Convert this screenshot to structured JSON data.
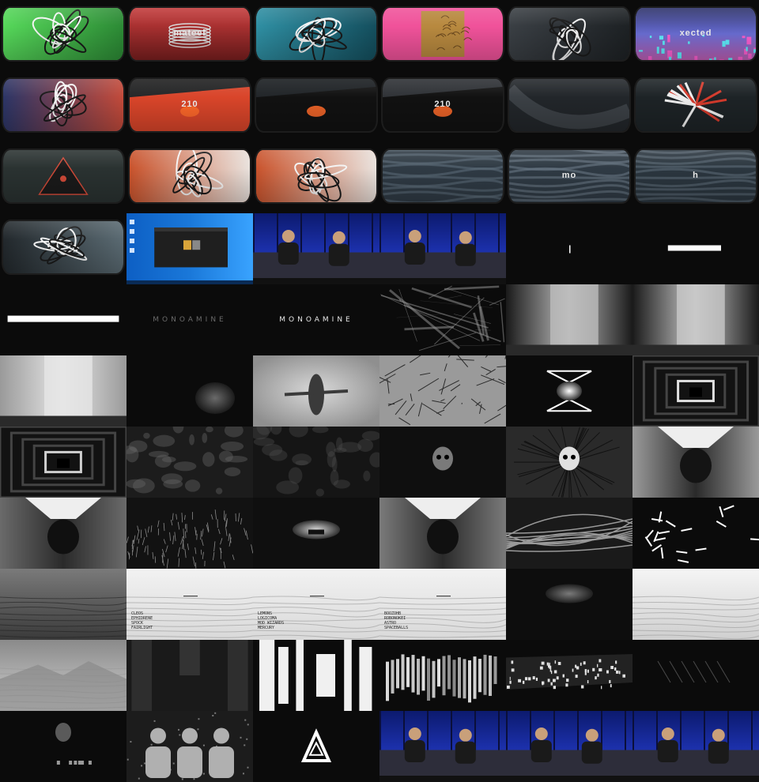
{
  "grid": {
    "columns": 6,
    "rows": 11,
    "background": "#0b0b0b"
  },
  "frames": [
    {
      "row": 0,
      "col": 0,
      "style": "crt",
      "scene": "green-twist",
      "colors": [
        "#56d85a",
        "#2c8a35"
      ],
      "caption": ""
    },
    {
      "row": 0,
      "col": 1,
      "style": "crt",
      "scene": "red-rings",
      "colors": [
        "#c23a3a",
        "#7a1f1f"
      ],
      "caption": "mateel"
    },
    {
      "row": 0,
      "col": 2,
      "style": "crt",
      "scene": "teal-knot",
      "colors": [
        "#2f8fa3",
        "#144f5e"
      ],
      "caption": ""
    },
    {
      "row": 0,
      "col": 3,
      "style": "crt",
      "scene": "pink-gold",
      "colors": [
        "#f0529a",
        "#b8893f"
      ],
      "caption": ""
    },
    {
      "row": 0,
      "col": 4,
      "style": "crt",
      "scene": "grey-chrome",
      "colors": [
        "#3a3f44",
        "#1d2124"
      ],
      "caption": ""
    },
    {
      "row": 0,
      "col": 5,
      "style": "crt",
      "scene": "purple-city",
      "colors": [
        "#6b6fd6",
        "#c05fb5"
      ],
      "caption": "xected"
    },
    {
      "row": 1,
      "col": 0,
      "style": "crt",
      "scene": "navy-swirl",
      "colors": [
        "#2c3566",
        "#c24a3a"
      ],
      "caption": ""
    },
    {
      "row": 1,
      "col": 1,
      "style": "crt",
      "scene": "210-red",
      "colors": [
        "#1c1c1c",
        "#d9452a"
      ],
      "caption": "210"
    },
    {
      "row": 1,
      "col": 2,
      "style": "crt",
      "scene": "210-dark",
      "colors": [
        "#15191c",
        "#d9452a"
      ],
      "caption": ""
    },
    {
      "row": 1,
      "col": 3,
      "style": "crt",
      "scene": "210-grey",
      "colors": [
        "#2a2d31",
        "#cc4a2a"
      ],
      "caption": "210"
    },
    {
      "row": 1,
      "col": 4,
      "style": "crt",
      "scene": "dark-curve",
      "colors": [
        "#22262a",
        "#3b4045"
      ],
      "caption": ""
    },
    {
      "row": 1,
      "col": 5,
      "style": "crt",
      "scene": "red-burst",
      "colors": [
        "#1d2326",
        "#d33a2c"
      ],
      "caption": ""
    },
    {
      "row": 2,
      "col": 0,
      "style": "crt",
      "scene": "dark-pyramid",
      "colors": [
        "#2a3231",
        "#d14a38"
      ],
      "caption": ""
    },
    {
      "row": 2,
      "col": 1,
      "style": "crt",
      "scene": "orange-chrome",
      "colors": [
        "#c9532c",
        "#e9e2dd"
      ],
      "caption": ""
    },
    {
      "row": 2,
      "col": 2,
      "style": "crt",
      "scene": "orange-chrome",
      "colors": [
        "#c9532c",
        "#e9e2dd"
      ],
      "caption": ""
    },
    {
      "row": 2,
      "col": 3,
      "style": "crt",
      "scene": "fabric",
      "colors": [
        "#2f3a44",
        "#5c6b78"
      ],
      "caption": ""
    },
    {
      "row": 2,
      "col": 4,
      "style": "crt",
      "scene": "fabric",
      "colors": [
        "#2f3a44",
        "#6a7885"
      ],
      "caption": "mo"
    },
    {
      "row": 2,
      "col": 5,
      "style": "crt",
      "scene": "fabric",
      "colors": [
        "#2b363f",
        "#5b6a76"
      ],
      "caption": "h"
    },
    {
      "row": 3,
      "col": 0,
      "style": "crt",
      "scene": "dark-logo",
      "colors": [
        "#22282c",
        "#5a6a72"
      ],
      "caption": ""
    },
    {
      "row": 3,
      "col": 1,
      "style": "full",
      "scene": "desktop",
      "colors": [
        "#1a78d9",
        "#1f1f1f"
      ],
      "caption": ""
    },
    {
      "row": 3,
      "col": 2,
      "style": "full",
      "scene": "stage",
      "colors": [
        "#1b2fa8",
        "#2d2d3a"
      ],
      "caption": ""
    },
    {
      "row": 3,
      "col": 3,
      "style": "full",
      "scene": "stage",
      "colors": [
        "#1b2fa8",
        "#2d2d3a"
      ],
      "caption": ""
    },
    {
      "row": 3,
      "col": 4,
      "style": "full",
      "scene": "tick",
      "colors": [
        "#0b0b0b",
        "#ffffff"
      ],
      "caption": ""
    },
    {
      "row": 3,
      "col": 5,
      "style": "full",
      "scene": "bar",
      "colors": [
        "#0b0b0b",
        "#ffffff"
      ],
      "caption": ""
    },
    {
      "row": 4,
      "col": 0,
      "style": "full",
      "scene": "bar-wide",
      "colors": [
        "#0b0b0b",
        "#ffffff"
      ],
      "caption": ""
    },
    {
      "row": 4,
      "col": 1,
      "style": "full",
      "scene": "title",
      "colors": [
        "#0b0b0b",
        "#6a6a6a"
      ],
      "caption": "MONOAMINE"
    },
    {
      "row": 4,
      "col": 2,
      "style": "full",
      "scene": "title-bright",
      "colors": [
        "#0b0b0b",
        "#ffffff"
      ],
      "caption": "MONOAMINE"
    },
    {
      "row": 4,
      "col": 3,
      "style": "full",
      "scene": "shards",
      "colors": [
        "#0b0b0b",
        "#9a9a9a"
      ],
      "caption": ""
    },
    {
      "row": 4,
      "col": 4,
      "style": "full",
      "scene": "room",
      "colors": [
        "#1a1a1a",
        "#bdbdbd"
      ],
      "caption": ""
    },
    {
      "row": 4,
      "col": 5,
      "style": "full",
      "scene": "room",
      "colors": [
        "#1a1a1a",
        "#c8c8c8"
      ],
      "caption": ""
    },
    {
      "row": 5,
      "col": 0,
      "style": "full",
      "scene": "room-wide",
      "colors": [
        "#9a9a9a",
        "#e6e6e6"
      ],
      "caption": ""
    },
    {
      "row": 5,
      "col": 1,
      "style": "full",
      "scene": "glow",
      "colors": [
        "#0b0b0b",
        "#5a5a5a"
      ],
      "caption": ""
    },
    {
      "row": 5,
      "col": 2,
      "style": "full",
      "scene": "figure",
      "colors": [
        "#8f8f8f",
        "#3a3a3a"
      ],
      "caption": ""
    },
    {
      "row": 5,
      "col": 3,
      "style": "full",
      "scene": "splinters",
      "colors": [
        "#9a9a9a",
        "#2a2a2a"
      ],
      "caption": ""
    },
    {
      "row": 5,
      "col": 4,
      "style": "full",
      "scene": "diamond",
      "colors": [
        "#0b0b0b",
        "#ffffff"
      ],
      "caption": ""
    },
    {
      "row": 5,
      "col": 5,
      "style": "full",
      "scene": "tunnel",
      "colors": [
        "#121212",
        "#e0e0e0"
      ],
      "caption": ""
    },
    {
      "row": 6,
      "col": 0,
      "style": "full",
      "scene": "tunnel",
      "colors": [
        "#121212",
        "#d0d0d0"
      ],
      "caption": ""
    },
    {
      "row": 6,
      "col": 1,
      "style": "full",
      "scene": "organic",
      "colors": [
        "#1c1c1c",
        "#6a6a6a"
      ],
      "caption": ""
    },
    {
      "row": 6,
      "col": 2,
      "style": "full",
      "scene": "organic",
      "colors": [
        "#151515",
        "#4a4a4a"
      ],
      "caption": ""
    },
    {
      "row": 6,
      "col": 3,
      "style": "full",
      "scene": "skull-blur",
      "colors": [
        "#0f0f0f",
        "#7a7a7a"
      ],
      "caption": ""
    },
    {
      "row": 6,
      "col": 4,
      "style": "full",
      "scene": "skull",
      "colors": [
        "#2a2a2a",
        "#e0e0e0"
      ],
      "caption": ""
    },
    {
      "row": 6,
      "col": 5,
      "style": "full",
      "scene": "chrome-room",
      "colors": [
        "#9a9a9a",
        "#141414"
      ],
      "caption": ""
    },
    {
      "row": 7,
      "col": 0,
      "style": "full",
      "scene": "chrome-room",
      "colors": [
        "#6a6a6a",
        "#101010"
      ],
      "caption": ""
    },
    {
      "row": 7,
      "col": 1,
      "style": "full",
      "scene": "grass",
      "colors": [
        "#121212",
        "#8a8a8a"
      ],
      "caption": ""
    },
    {
      "row": 7,
      "col": 2,
      "style": "full",
      "scene": "glow-floor",
      "colors": [
        "#0f0f0f",
        "#d6d6d6"
      ],
      "caption": ""
    },
    {
      "row": 7,
      "col": 3,
      "style": "full",
      "scene": "chrome-room",
      "colors": [
        "#7a7a7a",
        "#101010"
      ],
      "caption": ""
    },
    {
      "row": 7,
      "col": 4,
      "style": "full",
      "scene": "cables",
      "colors": [
        "#1a1a1a",
        "#9a9a9a"
      ],
      "caption": ""
    },
    {
      "row": 7,
      "col": 5,
      "style": "full",
      "scene": "sticks",
      "colors": [
        "#0b0b0b",
        "#ffffff"
      ],
      "caption": ""
    },
    {
      "row": 8,
      "col": 0,
      "style": "full",
      "scene": "terrain-dark",
      "colors": [
        "#3a3a3a",
        "#7a7a7a"
      ],
      "caption": ""
    },
    {
      "row": 8,
      "col": 1,
      "style": "full",
      "scene": "snow-credits",
      "colors": [
        "#d9d9d9",
        "#f2f2f2"
      ],
      "caption": "CLEOS\nEPHIDRENE\nSPOCK\nFAIRLIGHT"
    },
    {
      "row": 8,
      "col": 2,
      "style": "full",
      "scene": "snow-credits",
      "colors": [
        "#d9d9d9",
        "#f2f2f2"
      ],
      "caption": "LEMONS\nLOGICOMA\nMOD WIZARDS\nMERCURY"
    },
    {
      "row": 8,
      "col": 3,
      "style": "full",
      "scene": "snow-credits-right",
      "colors": [
        "#d9d9d9",
        "#f2f2f2"
      ],
      "caption": "BOOZOHB\nROBONOKEI\nASTRO\nSPACEBALLS"
    },
    {
      "row": 8,
      "col": 4,
      "style": "full",
      "scene": "dark-pile",
      "colors": [
        "#0d0d0d",
        "#6a6a6a"
      ],
      "caption": ""
    },
    {
      "row": 8,
      "col": 5,
      "style": "full",
      "scene": "snow",
      "colors": [
        "#cfcfcf",
        "#f5f5f5"
      ],
      "caption": ""
    },
    {
      "row": 9,
      "col": 0,
      "style": "full",
      "scene": "mountains",
      "colors": [
        "#d2d2d2",
        "#8a8a8a"
      ],
      "caption": ""
    },
    {
      "row": 9,
      "col": 1,
      "style": "full",
      "scene": "pillars",
      "colors": [
        "#1a1a1a",
        "#6a6a6a"
      ],
      "caption": ""
    },
    {
      "row": 9,
      "col": 2,
      "style": "full",
      "scene": "blocks",
      "colors": [
        "#0b0b0b",
        "#f0f0f0"
      ],
      "caption": ""
    },
    {
      "row": 9,
      "col": 3,
      "style": "full",
      "scene": "blocks-perspective",
      "colors": [
        "#0b0b0b",
        "#f0f0f0"
      ],
      "caption": ""
    },
    {
      "row": 9,
      "col": 4,
      "style": "full",
      "scene": "noise-panel",
      "colors": [
        "#0b0b0b",
        "#e0e0e0"
      ],
      "caption": ""
    },
    {
      "row": 9,
      "col": 5,
      "style": "full",
      "scene": "dark-glints",
      "colors": [
        "#0b0b0b",
        "#8a8a8a"
      ],
      "caption": ""
    },
    {
      "row": 10,
      "col": 0,
      "style": "full",
      "scene": "ghost",
      "colors": [
        "#0b0b0b",
        "#9a9a9a"
      ],
      "caption": ""
    },
    {
      "row": 10,
      "col": 1,
      "style": "full",
      "scene": "busts",
      "colors": [
        "#1c1c1c",
        "#b0b0b0"
      ],
      "caption": ""
    },
    {
      "row": 10,
      "col": 2,
      "style": "full",
      "scene": "logo",
      "colors": [
        "#0b0b0b",
        "#ffffff"
      ],
      "caption": ""
    },
    {
      "row": 10,
      "col": 3,
      "style": "full",
      "scene": "stage",
      "colors": [
        "#1b2fa8",
        "#2d2d3a"
      ],
      "caption": ""
    },
    {
      "row": 10,
      "col": 4,
      "style": "full",
      "scene": "stage",
      "colors": [
        "#1b2fa8",
        "#2d2d3a"
      ],
      "caption": ""
    },
    {
      "row": 10,
      "col": 5,
      "style": "full",
      "scene": "stage",
      "colors": [
        "#1b2fa8",
        "#2d2d3a"
      ],
      "caption": ""
    }
  ]
}
